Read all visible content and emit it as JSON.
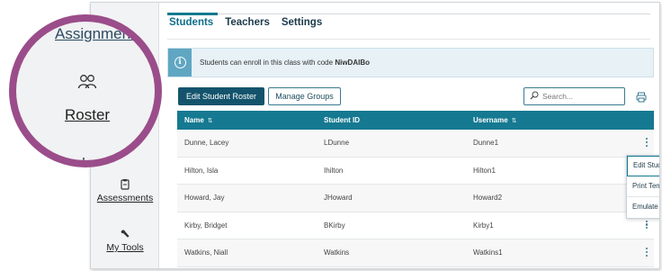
{
  "sidebar": {
    "items": [
      {
        "label": "Assessments",
        "icon": "clipboard-icon"
      },
      {
        "label": "My Tools",
        "icon": "wrench-icon"
      }
    ]
  },
  "zoom_callout": {
    "top_label": "Assignments",
    "roster_label": "Roster",
    "roster_icon": "people-icon",
    "bottom_icon": "line-chart-icon"
  },
  "tabs": [
    {
      "label": "Students",
      "active": true
    },
    {
      "label": "Teachers",
      "active": false
    },
    {
      "label": "Settings",
      "active": false
    }
  ],
  "info_banner": {
    "text": "Students can enroll in this class with code",
    "code": "NiwDAIBo"
  },
  "toolbar": {
    "edit_roster_label": "Edit Student Roster",
    "manage_groups_label": "Manage Groups",
    "search_placeholder": "Search..."
  },
  "table": {
    "columns": [
      "Name",
      "Student ID",
      "Username"
    ],
    "sort_glyph": "⇅",
    "rows": [
      {
        "name": "Dunne, Lacey",
        "student_id": "LDunne",
        "username": "Dunne1"
      },
      {
        "name": "Hilton, Isla",
        "student_id": "Ihilton",
        "username": "Hilton1"
      },
      {
        "name": "Howard, Jay",
        "student_id": "JHoward",
        "username": "Howard2"
      },
      {
        "name": "Kirby, Bridget",
        "student_id": "BKirby",
        "username": "Kirby1"
      },
      {
        "name": "Watkins, Niall",
        "student_id": "Watkins",
        "username": "Watkins1"
      }
    ]
  },
  "row_menu": {
    "items": [
      "Edit Student",
      "Print Temporary Password",
      "Emulate this Student"
    ]
  },
  "colors": {
    "accent": "#137a8f",
    "header": "#157991",
    "primary_button": "#13546c",
    "callout_ring": "#9a4d8a"
  }
}
